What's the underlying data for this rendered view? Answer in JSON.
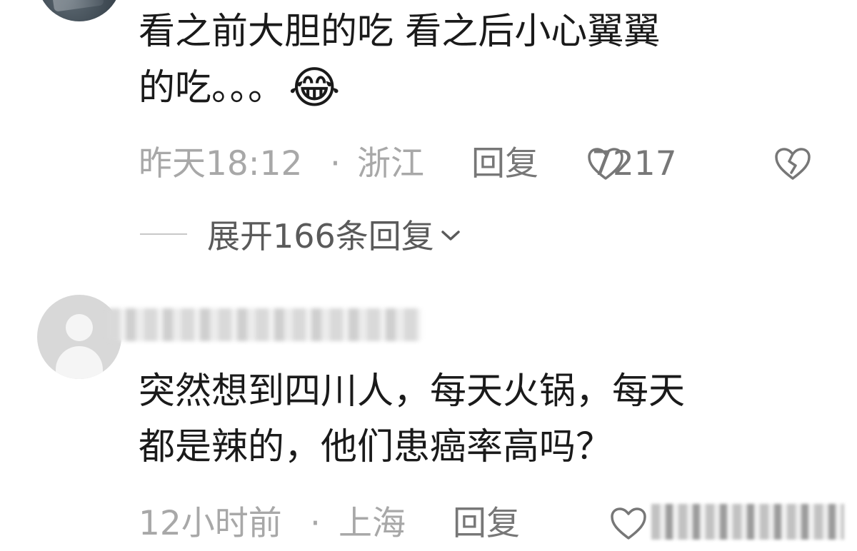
{
  "comments": [
    {
      "text": "看之前大胆的吃 看之后小心翼翼\n的吃。。。",
      "emoji": "😂",
      "emoji_icon": "face-with-tears-of-joy-icon",
      "time": "昨天18:12",
      "separator": "·",
      "location": "浙江",
      "reply_label": "回复",
      "like_count": "7217",
      "expand_label": "展开166条回复"
    },
    {
      "text": "突然想到四川人，每天火锅，每天\n都是辣的，他们患癌率高吗？",
      "time": "12小时前",
      "separator": "·",
      "location": "上海",
      "reply_label": "回复"
    }
  ],
  "colors": {
    "text": "#1a1a1a",
    "meta": "#a8a8a8",
    "action": "#777777",
    "expand": "#5a5a5a",
    "avatar_placeholder": "#d8d8d8"
  }
}
